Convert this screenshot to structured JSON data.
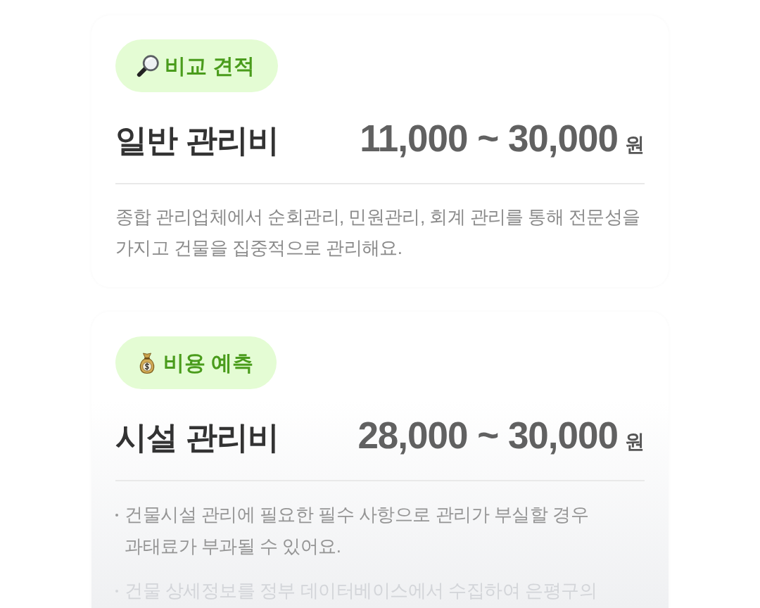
{
  "cards": [
    {
      "kind": "paragraph",
      "badge": "비교 견적",
      "title": "일반 관리비",
      "price": "11,000 ~ 30,000",
      "unit": "원",
      "description": "종합 관리업체에서 순회관리, 민원관리, 회계 관리를 통해 전문성을 가지고 건물을 집중적으로 관리해요."
    },
    {
      "kind": "bullets",
      "badge": "비용 예측",
      "title": "시설 관리비",
      "price": "28,000 ~ 30,000",
      "unit": "원",
      "bullets": [
        "건물시설 관리에 필요한 필수 사항으로 관리가 부실할 경우 과태료가 부과될 수 있어요.",
        "건물 상세정보를 정부 데이터베이스에서 수집하여 은평구의"
      ]
    }
  ]
}
